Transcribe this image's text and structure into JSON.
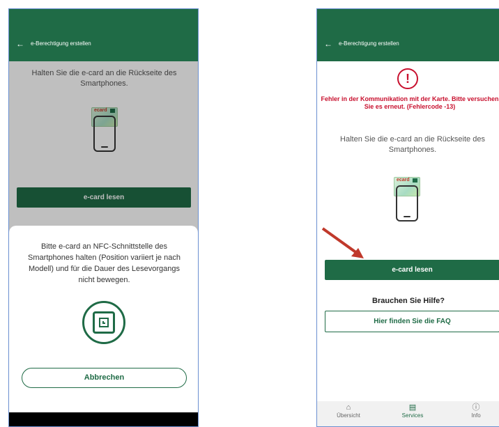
{
  "left": {
    "header": {
      "back_icon": "←",
      "title": "e-Berechtigung erstellen"
    },
    "instruction": "Halten Sie die e-card an die Rückseite des Smartphones.",
    "card_label": "ecard",
    "read_button": "e-card lesen",
    "sheet": {
      "message": "Bitte e-card an NFC-Schnittstelle des Smartphones halten (Position variiert je nach Modell) und für die Dauer des Lesevorgangs nicht bewegen.",
      "icon": "nfc-icon",
      "cancel_button": "Abbrechen"
    }
  },
  "right": {
    "header": {
      "back_icon": "←",
      "title": "e-Berechtigung erstellen"
    },
    "error_icon": "!",
    "error_message": "Fehler in der Kommunikation mit der Karte. Bitte versuchen Sie es erneut. (Fehlercode -13)",
    "instruction": "Halten Sie die e-card an die Rückseite des Smartphones.",
    "card_label": "ecard",
    "read_button": "e-card lesen",
    "help_title": "Brauchen Sie Hilfe?",
    "faq_button": "Hier finden Sie die FAQ",
    "nav": [
      {
        "label": "Übersicht",
        "icon": "⌂",
        "active": false
      },
      {
        "label": "Services",
        "icon": "▤",
        "active": true
      },
      {
        "label": "Info",
        "icon": "ⓘ",
        "active": false
      }
    ]
  },
  "colors": {
    "primary": "#1f6b46",
    "error": "#c8102e",
    "arrow": "#c0392b"
  }
}
